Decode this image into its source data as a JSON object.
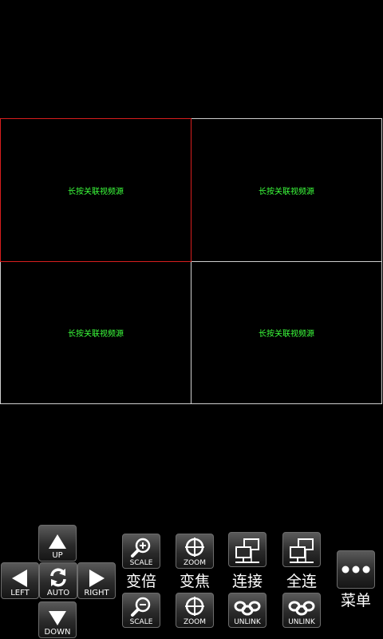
{
  "video_grid": {
    "cells": [
      {
        "label": "长按关联视频源",
        "selected": true
      },
      {
        "label": "长按关联视频源",
        "selected": false
      },
      {
        "label": "长按关联视频源",
        "selected": false
      },
      {
        "label": "长按关联视频源",
        "selected": false
      }
    ],
    "selected_border_color": "#d81e1e",
    "label_color": "#3cff3c"
  },
  "ptz": {
    "up": "UP",
    "left": "LEFT",
    "auto": "AUTO",
    "right": "RIGHT",
    "down": "DOWN"
  },
  "controls": {
    "zoom_in_label": "SCALE",
    "zoom_in_caption": "变倍",
    "zoom_out_label": "SCALE",
    "focus_in_label": "ZOOM",
    "focus_caption": "变焦",
    "focus_out_label": "ZOOM",
    "connect_caption": "连接",
    "unlink_label": "UNLINK",
    "connect_all_caption": "全连",
    "unlink_all_label": "UNLINK",
    "menu_caption": "菜单"
  },
  "icons": {
    "up": "arrow-up-icon",
    "left": "arrow-left-icon",
    "auto": "rotate-icon",
    "right": "arrow-right-icon",
    "down": "arrow-down-icon",
    "scale_in": "magnifier-plus-icon",
    "scale_out": "magnifier-minus-icon",
    "zoom": "crosshair-icon",
    "connect": "network-icon",
    "unlink": "chain-link-icon",
    "menu": "more-dots-icon"
  }
}
